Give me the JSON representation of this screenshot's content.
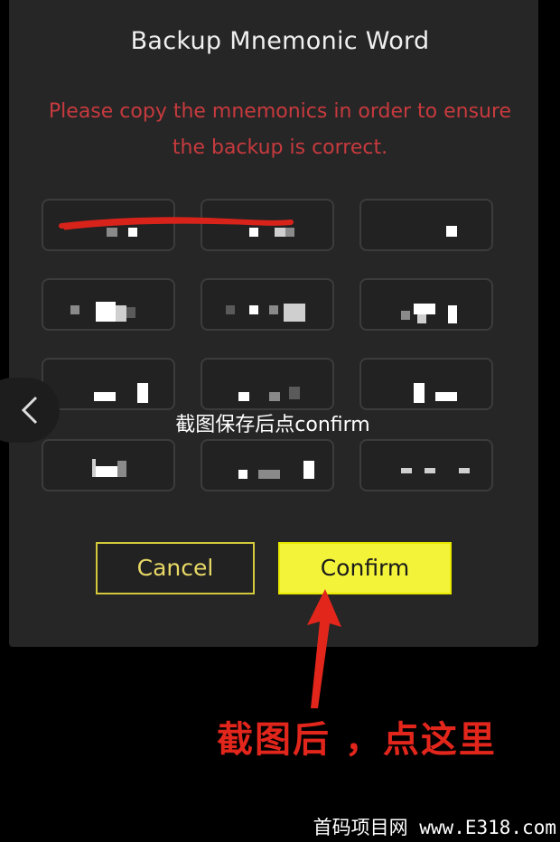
{
  "dialog": {
    "title": "Backup Mnemonic Word",
    "warning_line1": "Please copy the mnemonics in order to ensure",
    "warning_line2": "the backup is correct.",
    "word_count": 12
  },
  "overlay": {
    "instruction": "截图保存后点confirm"
  },
  "buttons": {
    "cancel": "Cancel",
    "confirm": "Confirm"
  },
  "annotation": {
    "text": "截图后 ，点这里",
    "color": "#e2261c"
  },
  "watermark": {
    "text": "首码项目网 www.E318.com"
  },
  "colors": {
    "warning": "#c73a3e",
    "confirm_bg": "#f3f33a",
    "cancel_border": "#d4c93a"
  },
  "icons": {
    "back": "chevron-left-icon",
    "arrow": "red-arrow-up-icon"
  }
}
